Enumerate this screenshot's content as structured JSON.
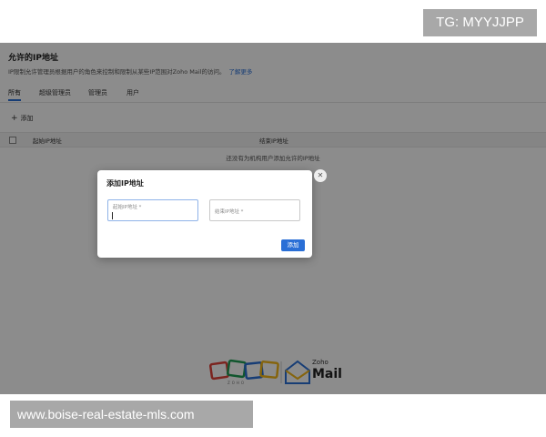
{
  "badge": {
    "text": "TG: MYYJJPP"
  },
  "watermark": {
    "text": "www.boise-real-estate-mls.com"
  },
  "page": {
    "title": "允许的IP地址",
    "description": "IP限制允许管理员根据用户的角色来控制和限制从某些IP范围对Zoho Mail的访问。",
    "learn_more": "了解更多",
    "tabs": [
      {
        "label": "所有",
        "active": true
      },
      {
        "label": "超级管理员",
        "active": false
      },
      {
        "label": "管理员",
        "active": false
      },
      {
        "label": "用户",
        "active": false
      }
    ],
    "add_label": "添加",
    "table": {
      "columns": [
        "起始IP地址",
        "结束IP地址"
      ],
      "empty_message": "还没有为机构用户添加允许的IP地址"
    }
  },
  "logo": {
    "sub": "ZOHO",
    "zoho": "Zoho",
    "mail": "Mail"
  },
  "modal": {
    "title": "添加IP地址",
    "start_field": {
      "label": "起始IP地址 *",
      "value": ""
    },
    "end_field": {
      "label": "结束IP地址 *",
      "value": ""
    },
    "submit_label": "添加",
    "close_symbol": "✕"
  },
  "colors": {
    "accent": "#2a6fd6",
    "overlay": "rgba(0,0,0,0.45)"
  }
}
